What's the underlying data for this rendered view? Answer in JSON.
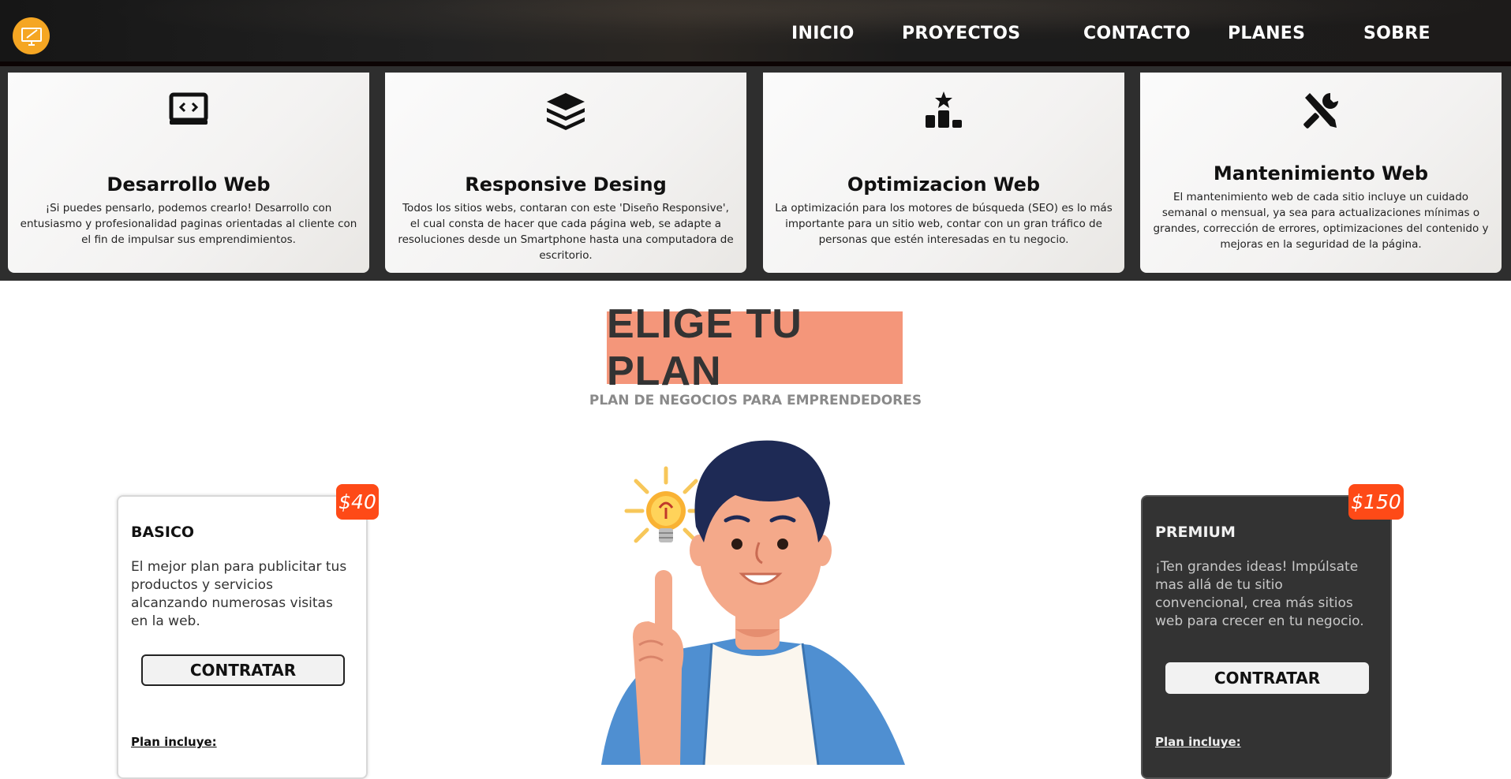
{
  "nav": {
    "links": [
      "INICIO",
      "PROYECTOS",
      "CONTACTO",
      "PLANES",
      "SOBRE"
    ],
    "logo_icon": "monitor-pen-icon"
  },
  "services": [
    {
      "icon": "code-window-icon",
      "title": "Desarrollo Web",
      "text": "¡Si puedes pensarlo, podemos crearlo! Desarrollo con entusiasmo y profesionalidad paginas orientadas al cliente con el fin de impulsar sus emprendimientos."
    },
    {
      "icon": "layers-icon",
      "title": "Responsive Desing",
      "text": "Todos los sitios webs, contaran con este 'Diseño Responsive', el cual consta de hacer que cada página web, se adapte a resoluciones desde un Smartphone hasta una computadora de escritorio."
    },
    {
      "icon": "ranking-podium-icon",
      "title": "Optimizacion Web",
      "text": "La optimización para los motores de búsqueda (SEO) es lo más importante para un sitio web, contar con un gran tráfico de personas que estén interesadas en tu negocio."
    },
    {
      "icon": "tools-icon",
      "title": "Mantenimiento Web",
      "text": "El mantenimiento web de cada sitio incluye un cuidado semanal o mensual, ya sea para actualizaciones mínimas o grandes, corrección de errores, optimizaciones del contenido y mejoras en la seguridad de la página."
    }
  ],
  "plans_section": {
    "title": "ELIGE TU PLAN",
    "subtitle": "PLAN DE NEGOCIOS PARA EMPRENDEDORES"
  },
  "plans": [
    {
      "name": "BASICO",
      "price": "$40",
      "description": "El mejor plan para publicitar tus productos y servicios alcanzando numerosas visitas en la web.",
      "button": "CONTRATAR",
      "includes": "Plan incluye:"
    },
    {
      "name": "PREMIUM",
      "price": "$150",
      "description": "¡Ten grandes ideas! Impúlsate mas allá de tu sitio convencional, crea más sitios web para crecer en tu negocio.",
      "button": "CONTRATAR",
      "includes": "Plan incluye:"
    }
  ],
  "colors": {
    "accent_orange": "#fe4a17",
    "title_bg": "#f4967a",
    "logo": "#f5a623",
    "dark": "#333333"
  }
}
